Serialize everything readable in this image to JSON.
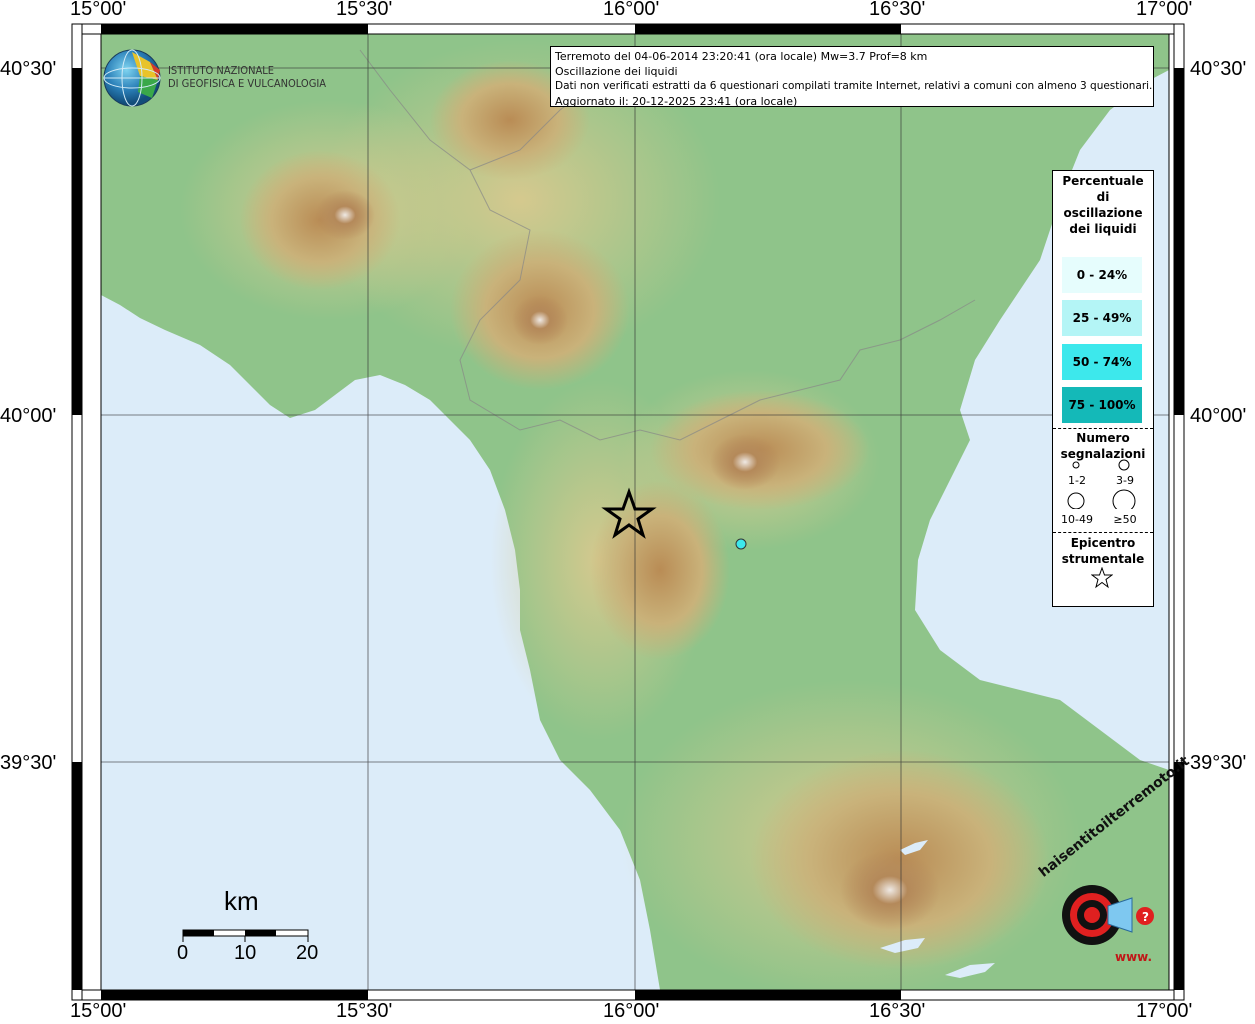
{
  "map": {
    "lon_ticks": [
      "15°00'",
      "15°30'",
      "16°00'",
      "16°30'",
      "17°00'"
    ],
    "lat_ticks": [
      "40°30'",
      "40°00'",
      "39°30'"
    ],
    "colors": {
      "sea": "#dcecf9",
      "land_low": "#8fc48a",
      "land_mid": "#c8c585",
      "land_high": "#a97c45",
      "peak": "#e6ddd6"
    }
  },
  "logo": {
    "line1": "ISTITUTO NAZIONALE",
    "line2": "DI GEOFISICA E VULCANOLOGIA"
  },
  "info": {
    "line1": "Terremoto del 04-06-2014 23:20:41 (ora locale) Mw=3.7 Prof=8 km",
    "line2": "Oscillazione dei liquidi",
    "line3": "Dati non verificati estratti da 6 questionari compilati tramite Internet, relativi a comuni con almeno 3 questionari.",
    "line4": "Aggiornato il: 20-12-2025 23:41 (ora locale)"
  },
  "legend": {
    "title": "Percentuale di oscillazione dei liquidi",
    "classes": [
      {
        "label": "0 - 24%",
        "color": "#e6fdfd"
      },
      {
        "label": "25 - 49%",
        "color": "#b4f5f6"
      },
      {
        "label": "50 - 74%",
        "color": "#3de8ec"
      },
      {
        "label": "75 - 100%",
        "color": "#14b9b8"
      }
    ],
    "count_title": "Numero segnalazioni",
    "count_labels": [
      "1-2",
      "3-9",
      "10-49",
      "≥50"
    ],
    "epicenter_title": "Epicentro strumentale"
  },
  "scale": {
    "title": "km",
    "labels": [
      "0",
      "10",
      "20"
    ]
  },
  "badge": {
    "text": "haisentitoilterremoto.it",
    "prefix": "www."
  }
}
